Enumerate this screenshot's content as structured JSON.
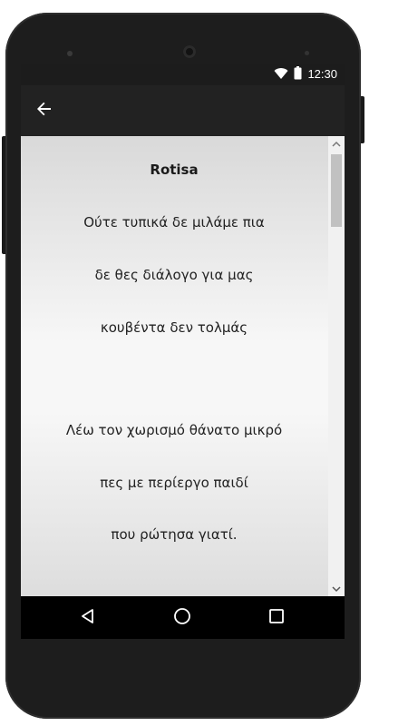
{
  "status_bar": {
    "time": "12:30",
    "icons": [
      "wifi-icon",
      "battery-icon"
    ]
  },
  "app_bar": {
    "back_icon": "arrow-left-icon"
  },
  "lyrics": {
    "title": "Rotisa",
    "lines": [
      "Ούτε τυπικά δε μιλάμε πια",
      "δε θες διάλογο για μας",
      "κουβέντα δεν τολμάς",
      "",
      "Λέω τον χωρισμό θάνατο μικρό",
      "πες με περίεργο παιδί",
      "που ρώτησα γιατί."
    ]
  },
  "nav_bar": {
    "icons": [
      "back-triangle-icon",
      "home-circle-icon",
      "recents-square-icon"
    ]
  }
}
